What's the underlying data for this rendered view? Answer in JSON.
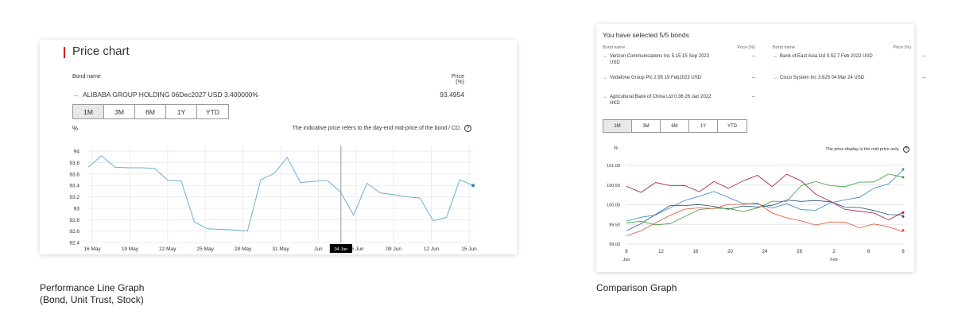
{
  "price_chart": {
    "title": "Price chart",
    "bond_name_header": "Bond name",
    "price_header_line1": "Price",
    "price_header_line2": "(%)",
    "bond_name": "ALIBABA GROUP HOLDING 06Dec2027 USD 3.400000%",
    "bond_price": "93.4954",
    "tabs": [
      "1M",
      "3M",
      "6M",
      "1Y",
      "YTD"
    ],
    "active_tab": "1M",
    "y_unit": "%",
    "note": "The indicative price refers to the day-end mid-price of the bond / CD.",
    "tooltip_date": "04 Jun",
    "series_color": "#6aafd6"
  },
  "comparison": {
    "title": "You have selected 5/5 bonds",
    "bond_name_header": "Bond name",
    "price_header": "Price (%)",
    "bonds": [
      {
        "name": "Verizon Communications Inc 5.15 15 Sep 2023 USD",
        "price": "--",
        "color": "#2e86c1"
      },
      {
        "name": "Bank of East Asia Ltd 0.52 7 Feb 2022 USD",
        "price": "--",
        "color": "#1f4e79"
      },
      {
        "name": "Vodafone Group Plc 2.95 19 Feb2023 USD",
        "price": "--",
        "color": "#3a9a3a"
      },
      {
        "name": "Cisco System Inc 3.625 04 Mar 24 USD",
        "price": "--",
        "color": "#e34b2c"
      },
      {
        "name": "Agricultural Bank of China Ltd 0.36 26 Jan 2022 HKD",
        "price": "--",
        "color": "#a3124a"
      }
    ],
    "tabs": [
      "1M",
      "3M",
      "6M",
      "1Y",
      "YTD"
    ],
    "active_tab": "1M",
    "y_unit": "%",
    "note": "The price display is the mid-price only.",
    "month_labels": [
      "Jan",
      "Feb"
    ]
  },
  "captions": {
    "left_line1": "Performance Line Graph",
    "left_line2": "(Bond, Unit Trust, Stock)",
    "right": "Comparison Graph"
  },
  "chart_data": [
    {
      "type": "line",
      "title": "",
      "xlabel": "",
      "ylabel": "%",
      "ylim": [
        92.4,
        94.1
      ],
      "yticks": [
        "92.4",
        "92.6",
        "92.8",
        "93",
        "93.2",
        "93.4",
        "93.6",
        "93.8",
        "94"
      ],
      "xticks": [
        "16 May",
        "19 May",
        "22 May",
        "25 May",
        "28 May",
        "31 May",
        "Jun",
        "06 Jun",
        "09 Jun",
        "12 Jun",
        "15 Jun"
      ],
      "grid": true,
      "series": [
        {
          "values": [
            93.72,
            93.92,
            93.72,
            93.71,
            93.71,
            93.7,
            93.49,
            93.48,
            92.76,
            92.64,
            92.63,
            92.62,
            92.6,
            93.5,
            93.61,
            93.89,
            93.45,
            93.47,
            93.49,
            93.29,
            92.88,
            93.44,
            93.27,
            93.24,
            93.2,
            93.18,
            92.78,
            92.84,
            93.5,
            93.4
          ]
        }
      ]
    },
    {
      "type": "line",
      "title": "",
      "xlabel": "",
      "ylabel": "%",
      "ylim": [
        99.0,
        101.0
      ],
      "yticks": [
        "99.00",
        "99.50",
        "100.00",
        "100.50",
        "101.00"
      ],
      "xticks": [
        "8",
        "12",
        "16",
        "20",
        "24",
        "28",
        "2",
        "6",
        "8"
      ],
      "grid": true,
      "legend": "top",
      "series": [
        {
          "name": "Verizon Communications Inc 5.15 15 Sep 2023 USD",
          "values": [
            99.58,
            99.65,
            99.78,
            99.9,
            100.1,
            100.25,
            100.3,
            100.2,
            100.05,
            99.98,
            99.95,
            100.02,
            99.85,
            99.9,
            100.02,
            100.12,
            100.22,
            100.38,
            100.55,
            100.9
          ]
        },
        {
          "name": "Bank of East Asia Ltd 0.52 7 Feb 2022 USD",
          "values": [
            99.3,
            99.55,
            99.75,
            99.95,
            100.02,
            99.98,
            99.95,
            99.92,
            99.93,
            99.96,
            100.0,
            100.08,
            100.12,
            100.1,
            100.05,
            99.98,
            99.9,
            99.85,
            99.78,
            99.7
          ]
        },
        {
          "name": "Vodafone Group Plc 2.95 19 Feb2023 USD",
          "values": [
            99.55,
            99.6,
            99.45,
            99.55,
            99.7,
            99.85,
            99.95,
            99.88,
            99.82,
            99.95,
            100.05,
            100.1,
            100.5,
            100.55,
            100.52,
            100.45,
            100.55,
            100.62,
            100.75,
            100.7
          ]
        },
        {
          "name": "Cisco System Inc 3.625 04 Mar 24 USD",
          "values": [
            99.25,
            99.3,
            99.55,
            99.75,
            99.85,
            99.95,
            99.9,
            99.98,
            100.05,
            100.02,
            99.78,
            99.7,
            99.55,
            99.5,
            99.58,
            99.52,
            99.45,
            99.5,
            99.42,
            99.35
          ]
        },
        {
          "name": "Agricultural Bank of China Ltd 0.36 26 Jan 2022 HKD",
          "values": [
            100.45,
            100.3,
            100.6,
            100.45,
            100.5,
            100.35,
            100.55,
            100.45,
            100.6,
            100.72,
            100.5,
            100.75,
            100.6,
            100.3,
            100.05,
            99.9,
            99.85,
            99.75,
            99.65,
            99.8
          ]
        }
      ]
    }
  ]
}
